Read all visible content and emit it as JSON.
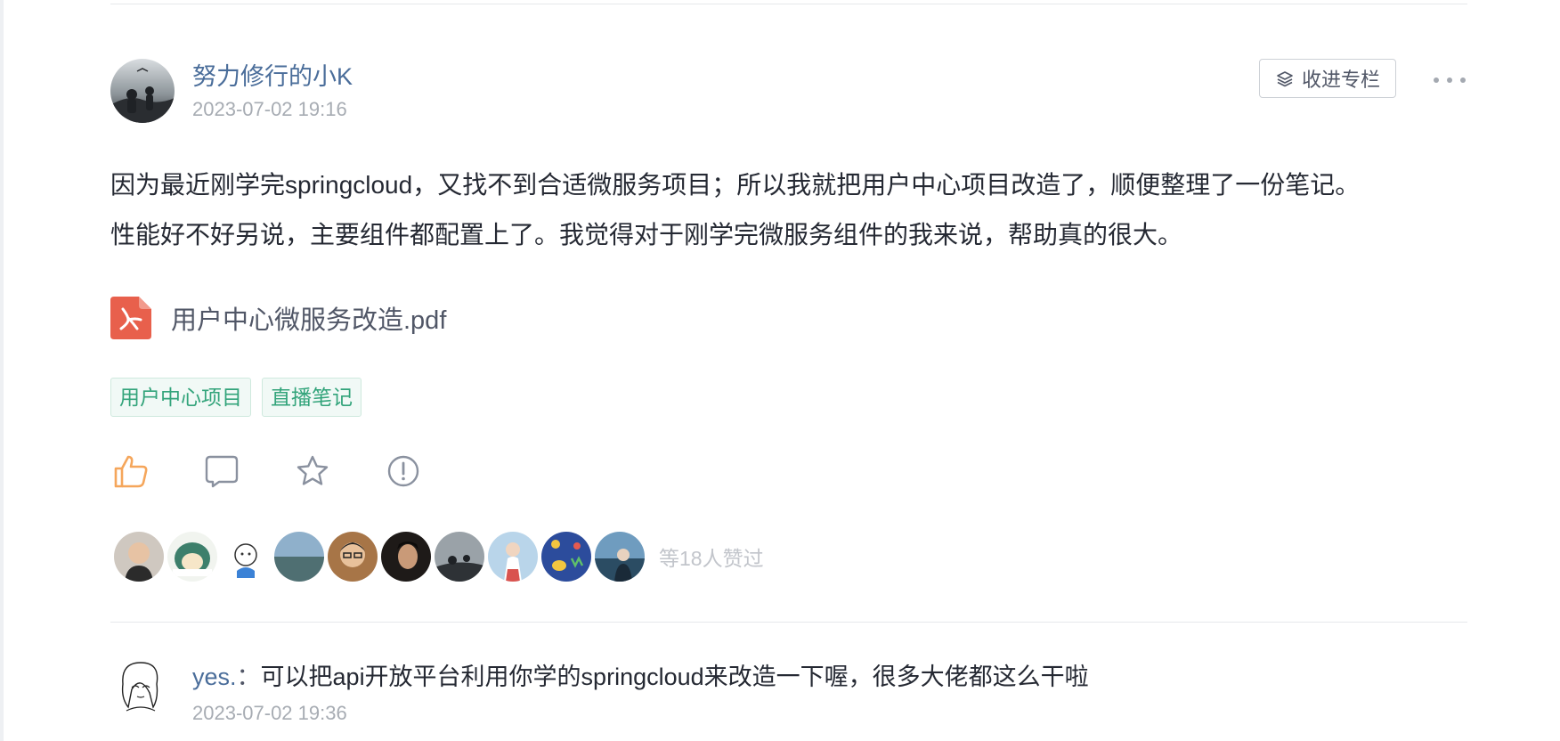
{
  "post": {
    "author": {
      "name": "努力修行的小K",
      "avatar": "author-avatar"
    },
    "time": "2023-07-02 19:16",
    "collect_label": "收进专栏",
    "content": [
      "因为最近刚学完springcloud，又找不到合适微服务项目；所以我就把用户中心项目改造了，顺便整理了一份笔记。",
      "性能好不好另说，主要组件都配置上了。我觉得对于刚学完微服务组件的我来说，帮助真的很大。"
    ],
    "attachment": {
      "icon": "pdf-icon",
      "filename": "用户中心微服务改造.pdf"
    },
    "tags": [
      "用户中心项目",
      "直播笔记"
    ],
    "actions": {
      "like": {
        "icon": "thumbs-up-icon",
        "color": "#f5a65b"
      },
      "comment": {
        "icon": "comment-icon"
      },
      "favorite": {
        "icon": "star-icon"
      },
      "report": {
        "icon": "exclamation-icon"
      }
    },
    "likers": {
      "count_label": "等18人赞过",
      "avatars": [
        {
          "name": "liker-avatar-1",
          "bg": "#6b5a4c"
        },
        {
          "name": "liker-avatar-2",
          "bg": "#4a8a6a"
        },
        {
          "name": "liker-avatar-3",
          "bg": "#ffffff"
        },
        {
          "name": "liker-avatar-4",
          "bg": "#6b8aa6"
        },
        {
          "name": "liker-avatar-5",
          "bg": "#b07a4a"
        },
        {
          "name": "liker-avatar-6",
          "bg": "#2c2622"
        },
        {
          "name": "liker-avatar-7",
          "bg": "#5a5f63"
        },
        {
          "name": "liker-avatar-8",
          "bg": "#8fb8d8"
        },
        {
          "name": "liker-avatar-9",
          "bg": "#2f4f9a"
        },
        {
          "name": "liker-avatar-10",
          "bg": "#2d4a5f"
        }
      ]
    }
  },
  "comment": {
    "user": "yes.",
    "separator": "：",
    "text": "可以把api开放平台利用你学的springcloud来改造一下喔，很多大佬都这么干啦",
    "time": "2023-07-02 19:36",
    "avatar": "comment-avatar"
  },
  "colors": {
    "link_blue": "#4a6d9a",
    "meta_gray": "#a7acb3",
    "tag_green": "#33a47b",
    "tag_bg": "#f1f9f6",
    "pdf_red": "#e8604c",
    "like_orange": "#f5a65b"
  }
}
